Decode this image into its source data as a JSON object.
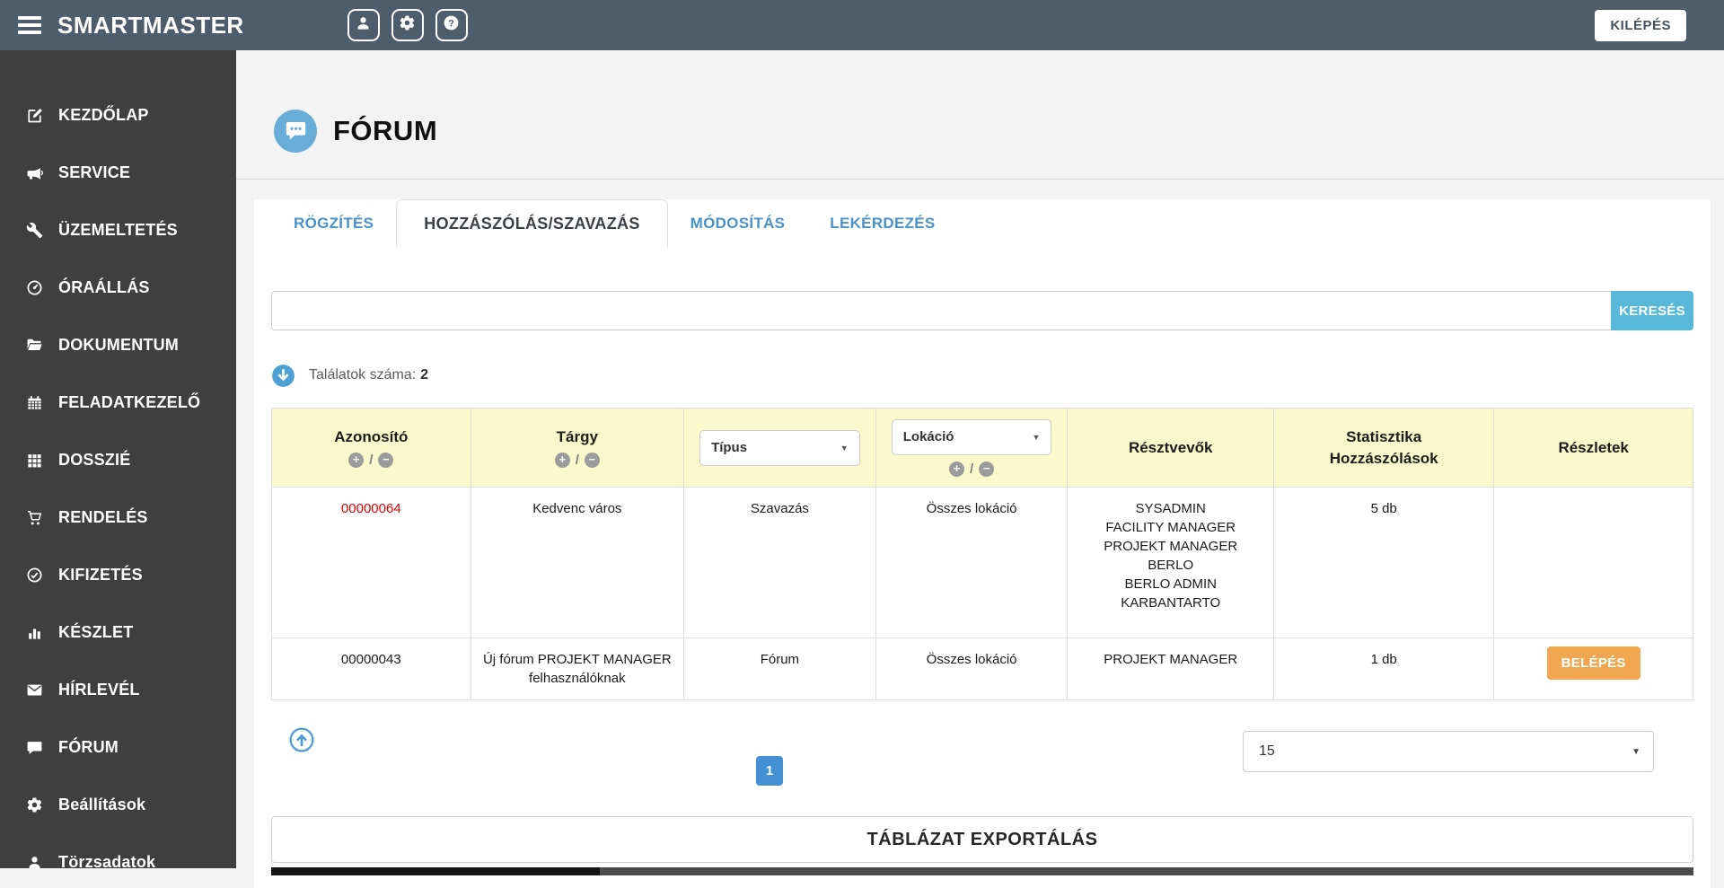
{
  "topbar": {
    "app_title": "SMARTMASTER",
    "logout_label": "KILÉPÉS"
  },
  "sidebar": {
    "items": [
      {
        "label": "KEZDŐLAP",
        "icon": "pencil-square"
      },
      {
        "label": "SERVICE",
        "icon": "bullhorn"
      },
      {
        "label": "ÜZEMELTETÉS",
        "icon": "wrench"
      },
      {
        "label": "ÓRAÁLLÁS",
        "icon": "tachometer"
      },
      {
        "label": "DOKUMENTUM",
        "icon": "folder-open"
      },
      {
        "label": "FELADATKEZELŐ",
        "icon": "calendar"
      },
      {
        "label": "DOSSZIÉ",
        "icon": "grid"
      },
      {
        "label": "RENDELÉS",
        "icon": "shopping-cart"
      },
      {
        "label": "KIFIZETÉS",
        "icon": "check-circle"
      },
      {
        "label": "KÉSZLET",
        "icon": "bar-chart"
      },
      {
        "label": "HÍRLEVÉL",
        "icon": "envelope"
      },
      {
        "label": "FÓRUM",
        "icon": "comment"
      },
      {
        "label": "Beállítások",
        "icon": "gear"
      },
      {
        "label": "Törzsadatok",
        "icon": "user"
      }
    ]
  },
  "page": {
    "title": "FÓRUM",
    "tabs": [
      {
        "label": "RÖGZÍTÉS",
        "active": false
      },
      {
        "label": "HOZZÁSZÓLÁS/SZAVAZÁS",
        "active": true
      },
      {
        "label": "MÓDOSÍTÁS",
        "active": false
      },
      {
        "label": "LEKÉRDEZÉS",
        "active": false
      }
    ],
    "search": {
      "value": "",
      "button_label": "KERESÉS"
    },
    "results": {
      "label": "Találatok száma:",
      "count": "2"
    }
  },
  "ui": {
    "sort_asc": "+",
    "sort_desc": "−",
    "sort_sep": "/",
    "caret": "▼"
  },
  "table": {
    "columns": [
      {
        "label": "Azonosító"
      },
      {
        "label": "Tárgy"
      },
      {
        "label": "Típus"
      },
      {
        "label": "Lokáció"
      },
      {
        "label": "Résztvevők"
      },
      {
        "label": "Statisztika",
        "label2": "Hozzászólások"
      },
      {
        "label": "Részletek"
      }
    ],
    "filters": {
      "tipus": "Típus",
      "lokacio": "Lokáció"
    },
    "rows": [
      {
        "azonosito": "00000064",
        "targy": "Kedvenc város",
        "tipus": "Szavazás",
        "lokacio": "Összes lokáció",
        "resztvevok": [
          "SYSADMIN",
          "FACILITY MANAGER",
          "PROJEKT MANAGER",
          "BERLO",
          "BERLO ADMIN",
          "KARBANTARTO"
        ],
        "statisztika": "5 db"
      },
      {
        "azonosito": "00000043",
        "targy": "Új fórum PROJEKT MANAGER felhasználóknak",
        "tipus": "Fórum",
        "lokacio": "Összes lokáció",
        "resztvevok": [
          "PROJEKT MANAGER"
        ],
        "statisztika": "1 db",
        "details_button": "BELÉPÉS"
      }
    ]
  },
  "pagination": {
    "current_page": "1",
    "page_size": "15"
  },
  "footer": {
    "export_label": "TÁBLÁZAT EXPORTÁLÁS"
  },
  "colors": {
    "topbar": "#4e5d6c",
    "sidebar": "#3f3f3f",
    "link_blue": "#4a92c7",
    "search_button_blue": "#57b8d9",
    "table_header_yellow": "#fbf8cc",
    "enter_button_orange": "#f0a74f",
    "pagination_blue": "#4390d4",
    "badge_blue": "#4e9fd4",
    "id_red": "#e10000"
  }
}
